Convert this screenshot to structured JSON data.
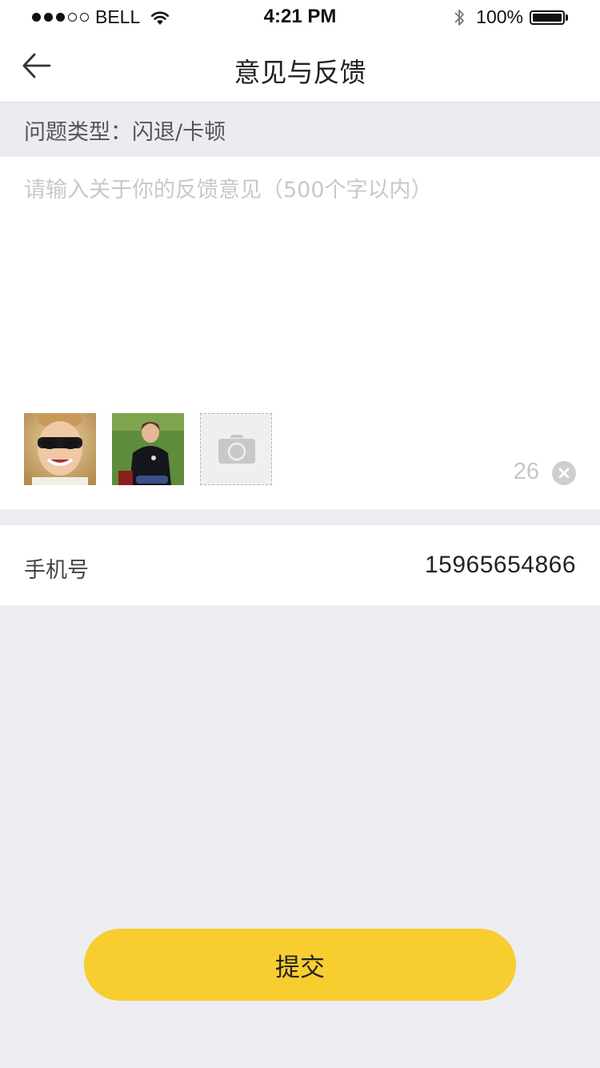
{
  "status_bar": {
    "carrier": "BELL",
    "signal_bars": 3,
    "signal_total": 5,
    "time": "4:21 PM",
    "battery_percent": "100%",
    "battery_level": 1.0,
    "icons": [
      "signal-dots-icon",
      "wifi-icon",
      "bluetooth-icon",
      "battery-icon"
    ]
  },
  "nav": {
    "title": "意见与反馈",
    "back_icon": "back-arrow-icon"
  },
  "issue_type": {
    "text": "问题类型：闪退/卡顿"
  },
  "feedback": {
    "placeholder": "请输入关于你的反馈意见（500个字以内）",
    "value": "",
    "char_count": "26",
    "clear_icon": "clear-circle-icon",
    "photos": [
      {
        "description_icon": "avatar-photo-man-sunglasses"
      },
      {
        "description_icon": "avatar-photo-woman-grass"
      }
    ],
    "add_photo_icon": "camera-icon"
  },
  "phone": {
    "label": "手机号",
    "value": "15965654866"
  },
  "submit": {
    "label": "提交"
  },
  "colors": {
    "accent": "#f7cd30",
    "background": "#ecedf1",
    "panel": "#ffffff",
    "placeholder": "#c8c8c8"
  }
}
